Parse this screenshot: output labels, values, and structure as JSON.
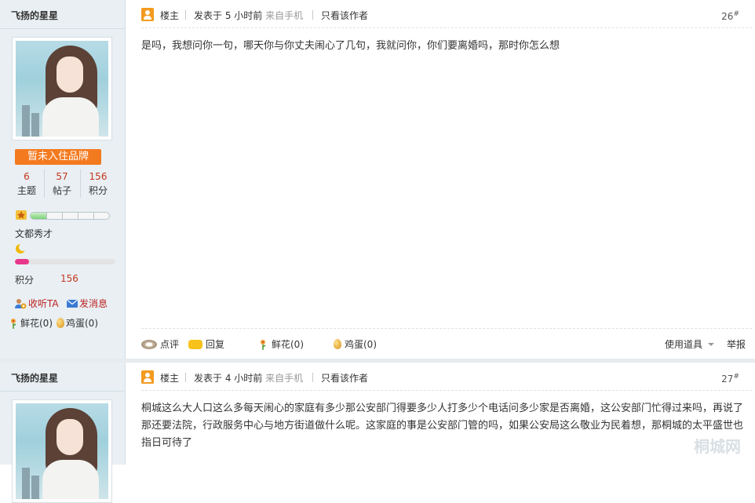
{
  "posts": [
    {
      "user": {
        "name": "飞扬的星星",
        "brand_button": "暂未入住品牌",
        "stats": [
          {
            "value": "6",
            "label": "主题"
          },
          {
            "value": "57",
            "label": "帖子"
          },
          {
            "value": "156",
            "label": "积分"
          }
        ],
        "level_name": "文都秀才",
        "level_progress": 0.2,
        "points_progress": 0.14,
        "points_label": "积分",
        "points_value": "156",
        "follow_label": "收听TA",
        "message_label": "发消息",
        "flower_label": "鲜花(0)",
        "egg_label": "鸡蛋(0)"
      },
      "header": {
        "owner_label": "楼主",
        "posted_text": "发表于 5 小时前",
        "source_text": "来自手机",
        "only_author_label": "只看该作者",
        "floor": "26",
        "floor_mark": "#"
      },
      "content": "是吗，我想问你一句，哪天你与你丈夫闹心了几句，我就问你，你们要离婚吗，那时你怎么想",
      "actions": {
        "comment": "点评",
        "reply": "回复",
        "flower": "鲜花(0)",
        "egg": "鸡蛋(0)",
        "tools": "使用道具",
        "report": "举报"
      }
    },
    {
      "user": {
        "name": "飞扬的星星"
      },
      "header": {
        "owner_label": "楼主",
        "posted_text": "发表于 4 小时前",
        "source_text": "来自手机",
        "only_author_label": "只看该作者",
        "floor": "27",
        "floor_mark": "#"
      },
      "content": "桐城这么大人口这么多每天闹心的家庭有多少那公安部门得要多少人打多少个电话问多少家是否离婚，这公安部门忙得过来吗，再说了那还要法院，行政服务中心与地方街道做什么呢。这家庭的事是公安部门管的吗，如果公安局这么敬业为民着想，那桐城的太平盛世也指日可待了"
    }
  ],
  "watermark": "桐城网",
  "colors": {
    "brand_orange": "#f47a1f",
    "stat_red": "#c4371c",
    "sidebar_bg": "#e9eff3",
    "points_pink": "#e8378a"
  }
}
